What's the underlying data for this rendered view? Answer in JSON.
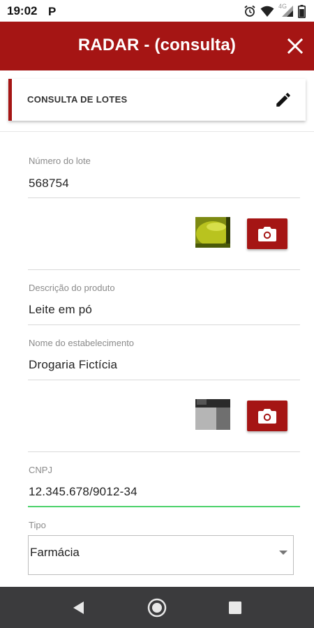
{
  "status_bar": {
    "time": "19:02",
    "network": "4G",
    "icons": [
      "parking-icon",
      "alarm-icon",
      "wifi-icon",
      "signal-icon",
      "battery-icon"
    ]
  },
  "app_bar": {
    "title": "RADAR - (consulta)",
    "close_icon": "close-icon",
    "color": "#a51514"
  },
  "section": {
    "label": "CONSULTA DE LOTES",
    "edit_icon": "pencil-icon"
  },
  "form": {
    "lote": {
      "label": "Número do lote",
      "value": "568754"
    },
    "descricao": {
      "label": "Descrição do produto",
      "value": "Leite em pó"
    },
    "estabelecimento": {
      "label": "Nome do estabelecimento",
      "value": "Drogaria Fictícia"
    },
    "cnpj": {
      "label": "CNPJ",
      "value": "12.345.678/9012-34"
    },
    "tipo": {
      "label": "Tipo",
      "value": "Farmácia"
    }
  },
  "colors": {
    "accent": "#a51514",
    "focus_line": "#4cd26b",
    "nav_bar": "#3b3b3d"
  },
  "nav": [
    "back-icon",
    "home-icon",
    "recents-icon"
  ]
}
